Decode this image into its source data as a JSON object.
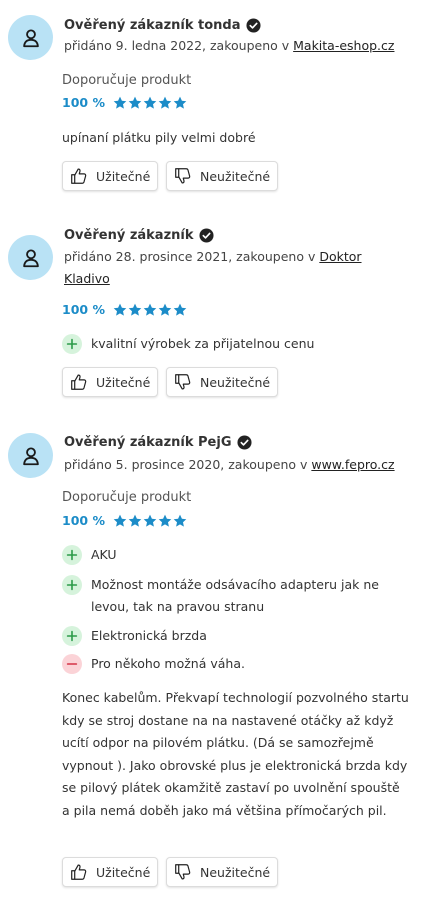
{
  "buttons": {
    "useful": "Užitečné",
    "not_useful": "Neužitečné"
  },
  "reviews": [
    {
      "name": "Ověřený zákazník tonda",
      "meta_prefix": "přidáno 9. ledna 2022, zakoupeno v ",
      "shop": "Makita-eshop.cz",
      "recommend": "Doporučuje produkt",
      "rating": "100 %",
      "text": "upínaní plátku pily velmi dobré"
    },
    {
      "name": "Ověřený zákazník",
      "meta_prefix": "přidáno 28. prosince 2021, zakoupeno v ",
      "shop": "Doktor Kladivo",
      "rating": "100 %",
      "pros": [
        "kvalitní výrobek za přijatelnou cenu"
      ]
    },
    {
      "name": "Ověřený zákazník PejG",
      "meta_prefix": "přidáno 5. prosince 2020, zakoupeno v ",
      "shop": "www.fepro.cz",
      "recommend": "Doporučuje produkt",
      "rating": "100 %",
      "pros": [
        "AKU",
        "Možnost montáže odsávacího adapteru jak ne levou, tak na pravou stranu",
        "Elektronická brzda"
      ],
      "cons": [
        "Pro někoho možná váha."
      ],
      "text": "Konec kabelům. Překvapí technologií pozvolného startu kdy se stroj dostane na na nastavené otáčky až když ucítí odpor na pilovém plátku. (Dá se samozřejmě vypnout ). Jako obrovské plus je elektronická brzda kdy se pilový plátek okamžitě zastaví po uvolnění spouště a pila nemá doběh jako má většina přímočarých pil."
    }
  ],
  "colors": {
    "accent": "#1c8cc8",
    "avatar_bg": "#b9e2f5",
    "pro_bg": "#d6f3dc",
    "con_bg": "#fbd3d7"
  },
  "icons": [
    "user-icon",
    "verified-check-icon",
    "star-icon",
    "plus-icon",
    "minus-icon",
    "thumbs-up-icon",
    "thumbs-down-icon"
  ]
}
